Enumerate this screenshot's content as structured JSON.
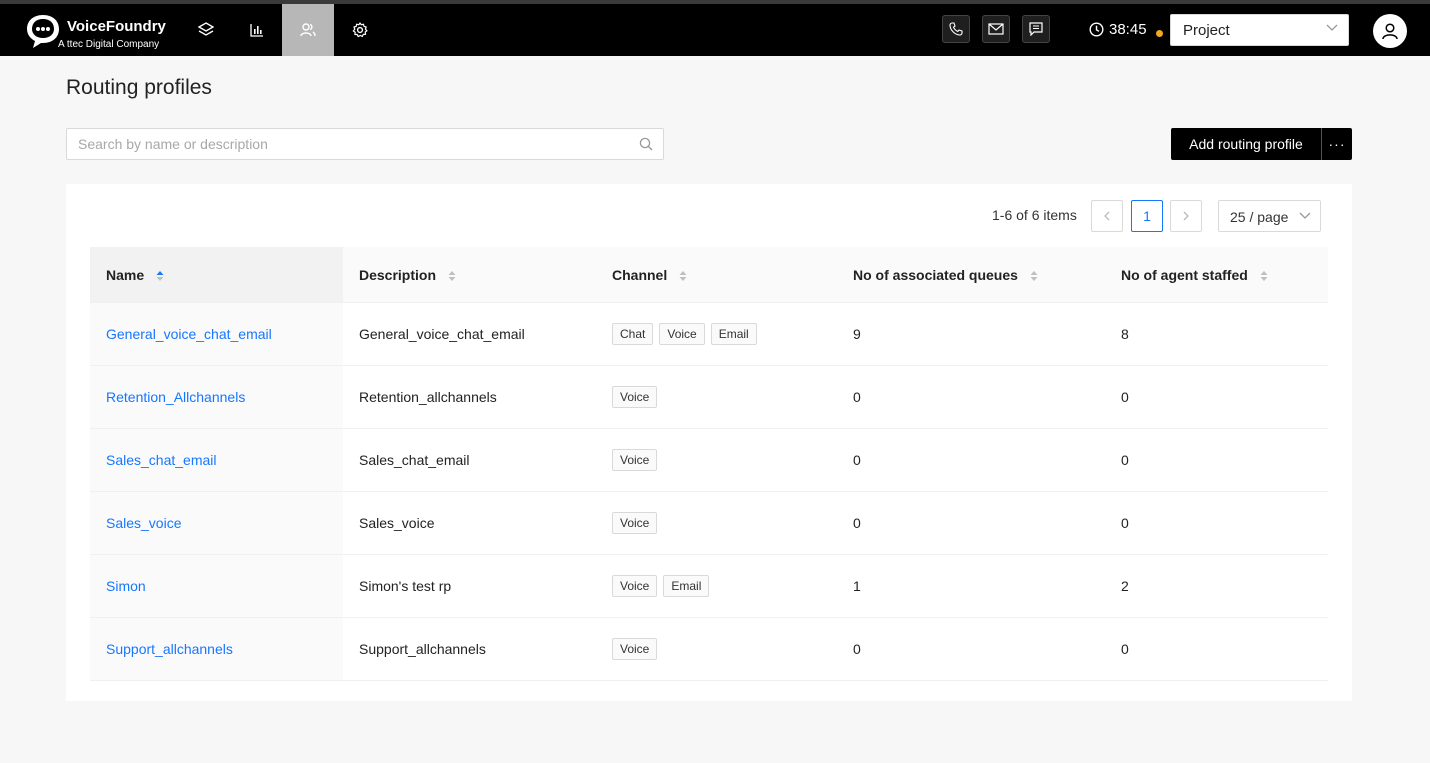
{
  "header": {
    "brand": "VoiceFoundry",
    "subtitle": "A ttec Digital Company",
    "timer": "38:45",
    "project_select": "Project"
  },
  "nav": [
    {
      "icon": "layers-icon"
    },
    {
      "icon": "bar-chart-icon"
    },
    {
      "icon": "users-icon",
      "active": true
    },
    {
      "icon": "gear-icon"
    }
  ],
  "channels_toolbar": [
    "phone-icon",
    "mail-icon",
    "chat-icon"
  ],
  "page": {
    "title": "Routing profiles",
    "search_placeholder": "Search by name or description",
    "add_button": "Add routing profile",
    "more_button": "···"
  },
  "pagination": {
    "info": "1-6 of 6 items",
    "current_page": "1",
    "page_size": "25 / page"
  },
  "table": {
    "columns": [
      "Name",
      "Description",
      "Channel",
      "No of associated queues",
      "No of agent staffed"
    ],
    "rows": [
      {
        "name": "General_voice_chat_email",
        "description": "General_voice_chat_email",
        "channels": [
          "Chat",
          "Voice",
          "Email"
        ],
        "queues": "9",
        "agents": "8"
      },
      {
        "name": "Retention_Allchannels",
        "description": "Retention_allchannels",
        "channels": [
          "Voice"
        ],
        "queues": "0",
        "agents": "0"
      },
      {
        "name": "Sales_chat_email",
        "description": "Sales_chat_email",
        "channels": [
          "Voice"
        ],
        "queues": "0",
        "agents": "0"
      },
      {
        "name": "Sales_voice",
        "description": "Sales_voice",
        "channels": [
          "Voice"
        ],
        "queues": "0",
        "agents": "0"
      },
      {
        "name": "Simon",
        "description": "Simon's test rp",
        "channels": [
          "Voice",
          "Email"
        ],
        "queues": "1",
        "agents": "2"
      },
      {
        "name": "Support_allchannels",
        "description": "Support_allchannels",
        "channels": [
          "Voice"
        ],
        "queues": "0",
        "agents": "0"
      }
    ]
  },
  "colors": {
    "link": "#1677ff",
    "status_dot": "#f5a623",
    "topbar": "#000000"
  }
}
